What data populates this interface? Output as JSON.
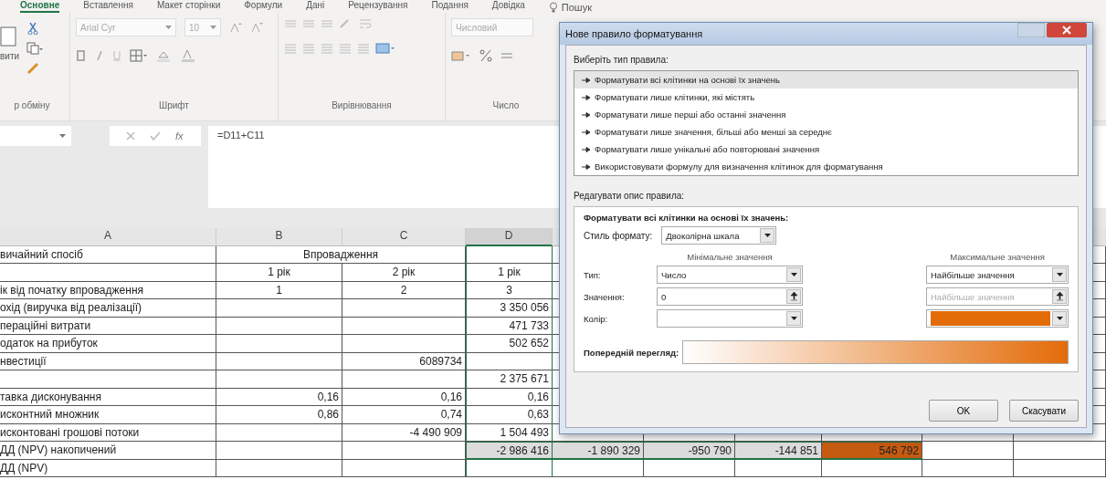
{
  "ribbon": {
    "tabs": [
      {
        "label": "Основне",
        "selected": true
      },
      {
        "label": "Вставлення",
        "selected": false
      },
      {
        "label": "Макет сторінки",
        "selected": false
      },
      {
        "label": "Формули",
        "selected": false
      },
      {
        "label": "Дані",
        "selected": false
      },
      {
        "label": "Рецензування",
        "selected": false
      },
      {
        "label": "Подання",
        "selected": false
      },
      {
        "label": "Довідка",
        "selected": false
      }
    ],
    "search": {
      "placeholder": "Пошук"
    },
    "clipboard": {
      "label": "р обміну",
      "button": "вити"
    },
    "font": {
      "label": "Шрифт",
      "name": "Arial Cyr",
      "size": "10"
    },
    "alignment": {
      "label": "Вирівнювання"
    },
    "number": {
      "label": "Число",
      "format": "Числовий"
    }
  },
  "formula_bar": {
    "fx": "fx",
    "formula": "=D11+C11"
  },
  "sheet": {
    "columns": [
      {
        "label": "A",
        "selected": false
      },
      {
        "label": "B",
        "selected": false
      },
      {
        "label": "C",
        "selected": false
      },
      {
        "label": "D",
        "selected": true
      }
    ],
    "group_header": "Впровадження",
    "rows": [
      {
        "kind": "data",
        "cells": [
          "вичайний спосіб",
          "",
          "",
          "",
          "",
          "",
          "",
          ""
        ],
        "selected": false
      },
      {
        "kind": "header",
        "cells": [
          "",
          "1 рік",
          "2 рік",
          "1 рік",
          "",
          "",
          "",
          ""
        ],
        "selected": false
      },
      {
        "kind": "header",
        "cells": [
          "ік від початку впровадження",
          "1",
          "2",
          "3",
          "",
          "",
          "",
          ""
        ],
        "selected": false
      },
      {
        "cells": [
          "охід (виручка від реалізації)",
          "",
          "",
          "3 350 056",
          "",
          "",
          "",
          ""
        ],
        "selected": false
      },
      {
        "cells": [
          "пераційні витрати",
          "",
          "",
          "471 733",
          "",
          "",
          "",
          ""
        ],
        "selected": false
      },
      {
        "cells": [
          "одаток на прибуток",
          "",
          "",
          "502 652",
          "",
          "",
          "",
          ""
        ],
        "selected": false
      },
      {
        "cells": [
          "нвестиції",
          "",
          "6089734",
          "",
          "",
          "",
          "",
          ""
        ],
        "selected": false
      },
      {
        "cells": [
          "",
          "",
          "",
          "2 375 671",
          "",
          "",
          "",
          ""
        ],
        "selected": false
      },
      {
        "cells": [
          "тавка дисконування",
          "0,16",
          "0,16",
          "0,16",
          "",
          "",
          "",
          ""
        ],
        "selected": false
      },
      {
        "cells": [
          "исконтний множник",
          "0,86",
          "0,74",
          "0,63",
          "",
          "",
          "",
          ""
        ],
        "selected": false
      },
      {
        "cells": [
          "исконтовані грошові потоки",
          "",
          "-4 490 909",
          "1 504 493",
          "",
          "",
          "",
          ""
        ],
        "selected": false
      },
      {
        "cells": [
          "ДД (NPV) накопичений",
          "",
          "",
          "-2 986 416",
          "-1 890 329",
          "-950 790",
          "-144 851",
          "546 792"
        ],
        "selected": true,
        "color": "#c55a11"
      },
      {
        "cells": [
          "ДД (NPV)",
          "",
          "",
          "",
          "",
          "",
          "",
          ""
        ],
        "selected": false
      }
    ]
  },
  "dialog": {
    "title": "Нове правило форматування",
    "rule_type_label": "Виберіть тип правила:",
    "rule_types": [
      {
        "label": "Форматувати всі клітинки на основі їх значень",
        "selected": true
      },
      {
        "label": "Форматувати лише клітинки, які містять",
        "selected": false
      },
      {
        "label": "Форматувати лише перші або останні значення",
        "selected": false
      },
      {
        "label": "Форматувати лише значення, більші або менші за середнє",
        "selected": false
      },
      {
        "label": "Форматувати лише унікальні або повторювані значення",
        "selected": false
      },
      {
        "label": "Використовувати формулу для визначення клітинок для форматування",
        "selected": false
      }
    ],
    "edit_label": "Редагувати опис правила:",
    "edit_heading": "Форматувати всі клітинки на основі їх значень:",
    "style_label": "Стиль формату:",
    "style_value": "Двоколірна шкала",
    "min_heading": "Мінімальне значення",
    "max_heading": "Максимальне значення",
    "type_label": "Тип:",
    "value_label": "Значення:",
    "color_label": "Колір:",
    "min": {
      "type": "Число",
      "value": "0",
      "color": "#ffffff"
    },
    "max": {
      "type": "Найбільше значення",
      "value": "Найбільше значення",
      "value_disabled": true,
      "color": "#e36c09"
    },
    "preview_label": "Попередній перегляд:",
    "buttons": [
      "OK",
      "Скасувати"
    ]
  }
}
